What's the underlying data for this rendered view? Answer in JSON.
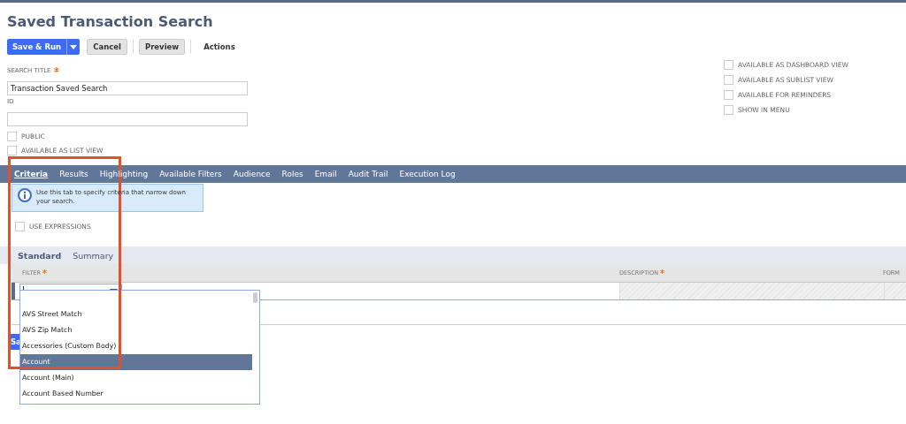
{
  "page_title": "Saved Transaction Search",
  "toolbar": {
    "primary": "Save & Run",
    "buttons": [
      "Cancel",
      "Preview"
    ],
    "actions": "Actions"
  },
  "fields": [
    {
      "label": "SEARCH TITLE",
      "required": true,
      "value": "Transaction Saved Search"
    },
    {
      "label": "ID",
      "required": false
    }
  ],
  "left_checks": [
    {
      "label": "PUBLIC",
      "checked": false
    },
    {
      "label": "AVAILABLE AS LIST VIEW",
      "checked": false
    }
  ],
  "right_checks": [
    {
      "label": "AVAILABLE AS DASHBOARD VIEW",
      "checked": false
    },
    {
      "label": "AVAILABLE AS SUBLIST VIEW",
      "checked": false
    },
    {
      "label": "AVAILABLE FOR REMINDERS",
      "checked": false
    },
    {
      "label": "SHOW IN MENU",
      "checked": false
    }
  ],
  "tabs": [
    {
      "label": "Criteria",
      "selected": true
    },
    {
      "label": "Results",
      "selected": false
    },
    {
      "label": "Highlighting",
      "selected": false
    },
    {
      "label": "Available Filters",
      "selected": false
    },
    {
      "label": "Audience",
      "selected": false
    },
    {
      "label": "Roles",
      "selected": false
    },
    {
      "label": "Email",
      "selected": false
    },
    {
      "label": "Audit Trail",
      "selected": false
    },
    {
      "label": "Execution Log",
      "selected": false
    }
  ],
  "info": "Use this tab to specify criteria that narrow down your search.",
  "use_expressions": {
    "label": "USE EXPRESSIONS",
    "checked": false
  },
  "subtabs": [
    {
      "label": "Standard",
      "selected": true
    },
    {
      "label": "Summary",
      "selected": false
    }
  ],
  "columns": [
    {
      "label": "FILTER",
      "required": true
    },
    {
      "label": "DESCRIPTION",
      "required": true
    },
    {
      "label": "FORM",
      "required": false
    }
  ],
  "dropdown_options": [
    {
      "label": "AVS Street Match",
      "selected": false
    },
    {
      "label": "AVS Zip Match",
      "selected": false
    },
    {
      "label": "Accessories (Custom Body)",
      "selected": false
    },
    {
      "label": "Account",
      "selected": true
    },
    {
      "label": "Account (Main)",
      "selected": false
    },
    {
      "label": "Account Based Number",
      "selected": false
    }
  ],
  "bottom_button": "Sa"
}
